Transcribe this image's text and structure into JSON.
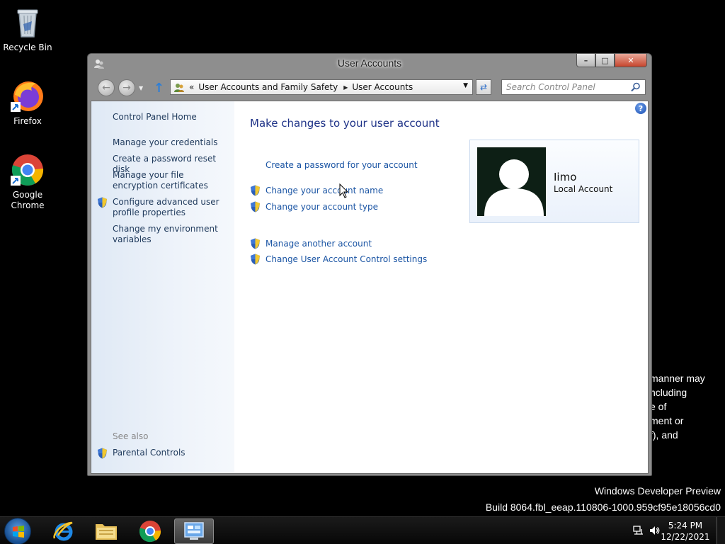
{
  "desktop": {
    "icons": [
      {
        "label": "Recycle Bin"
      },
      {
        "label": "Firefox"
      },
      {
        "label": "Google Chrome"
      }
    ],
    "background_text": "manner may\nncluding\ne of\nment or\nf), and",
    "watermark": {
      "line1": "Windows Developer Preview",
      "line2": "Build 8064.fbl_eeap.110806-1000.959cf95e18056cd0"
    }
  },
  "window": {
    "title": "User Accounts",
    "caption": {
      "minimize": "–",
      "maximize": "□",
      "close": "✕"
    },
    "address": {
      "prefix": "«",
      "crumbs": [
        "User Accounts and Family Safety",
        "User Accounts"
      ]
    },
    "search": {
      "placeholder": "Search Control Panel"
    },
    "left_pane": {
      "home": "Control Panel Home",
      "links": [
        "Manage your credentials",
        "Create a password reset disk",
        "Manage your file encryption certificates",
        "Configure advanced user profile properties",
        "Change my environment variables"
      ],
      "see_also_label": "See also",
      "see_also_links": [
        "Parental Controls"
      ]
    },
    "main": {
      "heading": "Make changes to your user account",
      "tasks": [
        "Create a password for your account",
        "Change your account name",
        "Change your account type",
        "Manage another account",
        "Change User Account Control settings"
      ],
      "help": "?",
      "user": {
        "name": "Iimo",
        "type": "Local Account"
      }
    }
  },
  "taskbar": {
    "clock_time": "5:24 PM",
    "clock_date": "12/22/2021"
  }
}
